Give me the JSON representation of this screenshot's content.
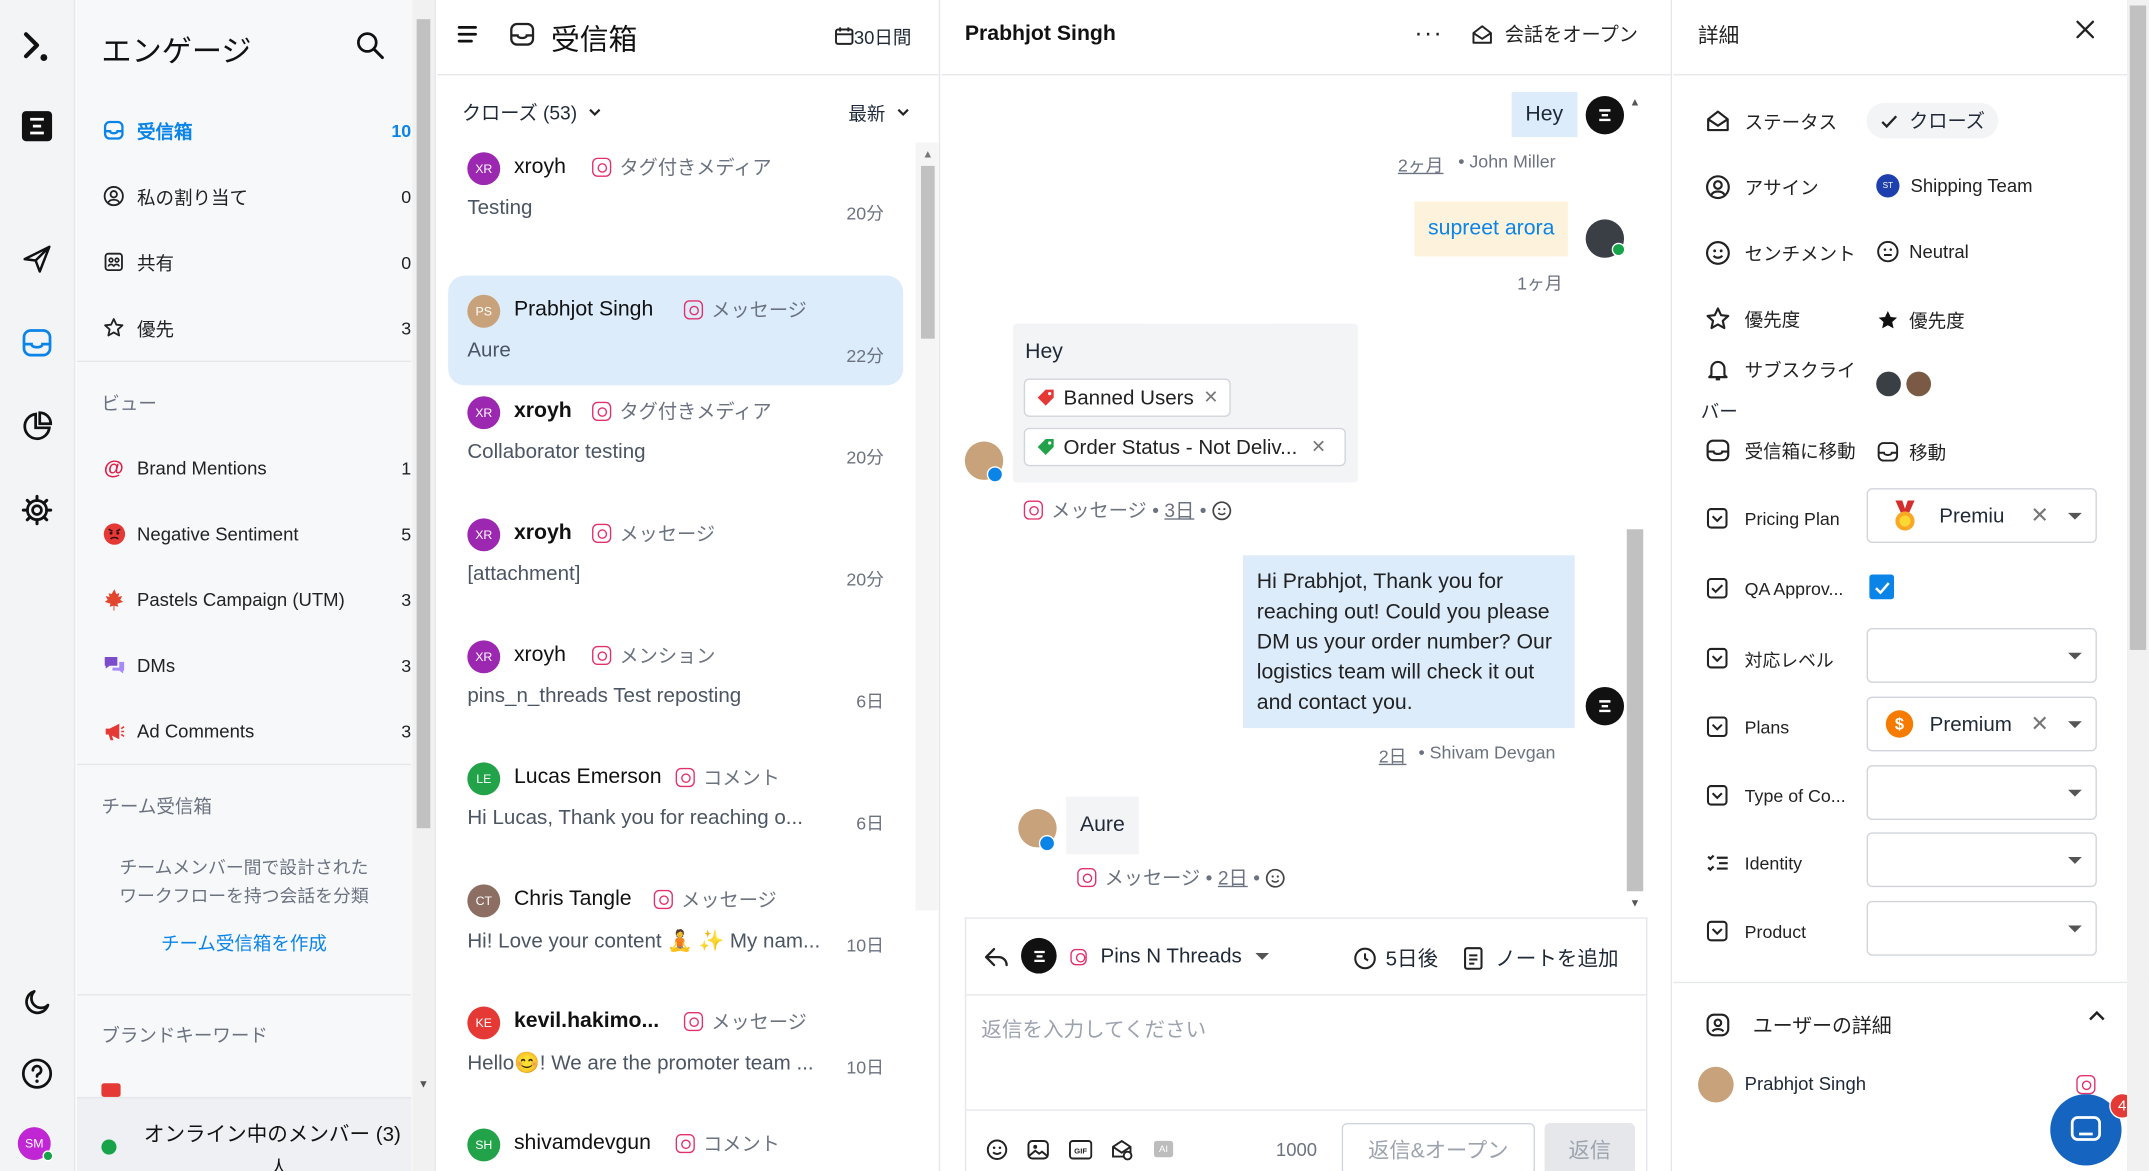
{
  "colors": {
    "accent": "#0b84e8",
    "selected": "#dcecfb",
    "agent_bubble": "#dcecfb",
    "yellow_bubble": "#fdf3dc",
    "gray_bubble": "#f3f4f6",
    "instagram": "#e1306c",
    "online": "#16a34a"
  },
  "rail": {
    "icons": [
      "logo-icon",
      "sprinklr-logo-icon",
      "send-icon",
      "inbox-icon",
      "pie-chart-icon",
      "gear-icon",
      "moon-icon",
      "help-icon"
    ],
    "user_initials": "SM"
  },
  "sidebar": {
    "title": "エンゲージ",
    "items": [
      {
        "label": "受信箱",
        "count": "10",
        "icon": "inbox-icon"
      },
      {
        "label": "私の割り当て",
        "count": "0",
        "icon": "user-circle-icon"
      },
      {
        "label": "共有",
        "count": "0",
        "icon": "shared-icon"
      },
      {
        "label": "優先",
        "count": "3",
        "icon": "star-icon"
      }
    ],
    "views_heading": "ビュー",
    "views": [
      {
        "label": "Brand Mentions",
        "count": "1",
        "icon": "at-icon"
      },
      {
        "label": "Negative Sentiment",
        "count": "5",
        "icon": "angry-face-icon"
      },
      {
        "label": "Pastels Campaign (UTM)",
        "count": "3",
        "icon": "maple-leaf-icon"
      },
      {
        "label": "DMs",
        "count": "3",
        "icon": "chat-bubbles-icon"
      },
      {
        "label": "Ad Comments",
        "count": "3",
        "icon": "megaphone-icon"
      }
    ],
    "team_heading": "チーム受信箱",
    "team_desc_1": "チームメンバー間で設計された",
    "team_desc_2": "ワークフローを持つ会話を分類",
    "team_create": "チーム受信箱を作成",
    "brand_heading": "ブランドキーワード",
    "online_label": "オンライン中のメンバー (3)",
    "online_extra": "人"
  },
  "list": {
    "title": "受信箱",
    "range": "30日間",
    "filter": "クローズ (53)",
    "sort": "最新",
    "conversations": [
      {
        "initials": "XR",
        "name": "xroyh",
        "type": "タグ付きメディア",
        "preview": "Testing",
        "time": "20分",
        "bold": false,
        "color": "#9c27b0"
      },
      {
        "initials": "PS",
        "name": "Prabhjot Singh",
        "type": "メッセージ",
        "preview": "Aure",
        "time": "22分",
        "bold": false,
        "color": "#c8a27a"
      },
      {
        "initials": "XR",
        "name": "xroyh",
        "type": "タグ付きメディア",
        "preview": "Collaborator testing",
        "time": "20分",
        "bold": true,
        "color": "#9c27b0"
      },
      {
        "initials": "XR",
        "name": "xroyh",
        "type": "メッセージ",
        "preview": "[attachment]",
        "time": "20分",
        "bold": true,
        "color": "#9c27b0"
      },
      {
        "initials": "XR",
        "name": "xroyh",
        "type": "メンション",
        "preview": "pins_n_threads Test reposting",
        "time": "6日",
        "bold": false,
        "color": "#9c27b0"
      },
      {
        "initials": "LE",
        "name": "Lucas Emerson",
        "type": "コメント",
        "preview": "Hi Lucas, Thank you for reaching o...",
        "time": "6日",
        "bold": false,
        "color": "#22a34a"
      },
      {
        "initials": "CT",
        "name": "Chris Tangle",
        "type": "メッセージ",
        "preview": "Hi! Love your content 🧘 ✨ My nam...",
        "time": "10日",
        "bold": false,
        "color": "#8d6e63"
      },
      {
        "initials": "KE",
        "name": "kevil.hakimo...",
        "type": "メッセージ",
        "preview": "Hello😊! We are the promoter team ...",
        "time": "10日",
        "bold": true,
        "color": "#e53935"
      },
      {
        "initials": "SH",
        "name": "shivamdevgun",
        "type": "コメント",
        "preview": "",
        "time": "",
        "bold": false,
        "color": "#22a34a"
      }
    ]
  },
  "chat": {
    "contact": "Prabhjot Singh",
    "open_label": "会話をオープン",
    "msg1": {
      "text": "Hey",
      "time": "2ヶ月",
      "author": "• John Miller"
    },
    "msg2": {
      "text": "supreet arora",
      "time": "1ヶ月"
    },
    "msg3": {
      "text": "Hey",
      "tags": [
        "Banned Users",
        "Order Status - Not Deliv..."
      ],
      "channel": "メッセージ",
      "time": "3日"
    },
    "msg4": {
      "lines": [
        "Hi Prabhjot, Thank you for",
        "reaching out! Could you please",
        "DM us your order number? Our",
        "logistics team will check it out",
        "and contact you."
      ],
      "time": "2日",
      "author": "• Shivam Devgan"
    },
    "msg5": {
      "text": "Aure",
      "channel": "メッセージ",
      "time": "2日"
    },
    "composer": {
      "account": "Pins N Threads",
      "snooze": "5日後",
      "note": "ノートを追加",
      "placeholder": "返信を入力してください",
      "char_count": "1000",
      "reply_open": "返信&オープン",
      "reply": "返信"
    }
  },
  "detail": {
    "title": "詳細",
    "status_label": "ステータス",
    "status_value": "クローズ",
    "assign_label": "アサイン",
    "assign_value": "Shipping Team",
    "assign_initials": "ST",
    "sentiment_label": "センチメント",
    "sentiment_value": "Neutral",
    "priority_label": "優先度",
    "priority_value": "優先度",
    "subscriber_label_1": "サブスクライ",
    "subscriber_label_2": "バー",
    "move_label": "受信箱に移動",
    "move_value": "移動",
    "fields": [
      {
        "label": "Pricing Plan",
        "value": "Premiu",
        "has_value": true,
        "badge": "medal"
      },
      {
        "label": "QA Approv...",
        "checkbox": true
      },
      {
        "label": "対応レベル",
        "value": "",
        "has_value": false
      },
      {
        "label": "Plans",
        "value": "Premium",
        "has_value": true,
        "badge": "dollar"
      },
      {
        "label": "Type of Co...",
        "value": "",
        "has_value": false
      },
      {
        "label": "Identity",
        "value": "",
        "has_value": false
      },
      {
        "label": "Product",
        "value": "",
        "has_value": false
      }
    ],
    "user_details_label": "ユーザーの詳細",
    "user_name": "Prabhjot Singh",
    "chat_badge": "4"
  }
}
